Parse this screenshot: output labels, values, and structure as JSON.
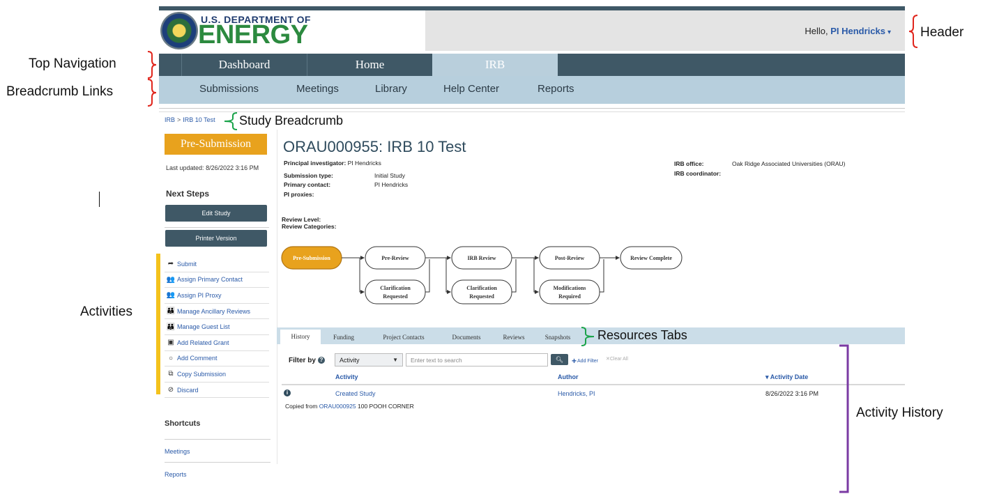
{
  "header": {
    "logo_line1": "U.S. DEPARTMENT OF",
    "logo_line2": "ENERGY",
    "greeting": "Hello,",
    "user_name": "PI Hendricks",
    "user_caret": "▾"
  },
  "top_nav": {
    "tabs": [
      {
        "label": "Dashboard"
      },
      {
        "label": "Home"
      },
      {
        "label": "IRB"
      }
    ],
    "active_tab": "IRB"
  },
  "sub_nav": {
    "links": [
      {
        "label": "Submissions"
      },
      {
        "label": "Meetings"
      },
      {
        "label": "Library"
      },
      {
        "label": "Help Center"
      },
      {
        "label": "Reports"
      }
    ]
  },
  "breadcrumb": {
    "root": "IRB",
    "separator": ">",
    "current": "IRB 10 Test"
  },
  "sidebar": {
    "status": "Pre-Submission",
    "last_updated_label": "Last updated:",
    "last_updated_value": "8/26/2022 3:16 PM",
    "next_steps_title": "Next Steps",
    "buttons": [
      {
        "label": "Edit Study"
      },
      {
        "label": "Printer Version"
      }
    ],
    "activities": [
      {
        "label": "Submit",
        "icon": "share-arrow-icon"
      },
      {
        "label": "Assign Primary Contact",
        "icon": "user-pair-icon"
      },
      {
        "label": "Assign PI Proxy",
        "icon": "user-pair-icon"
      },
      {
        "label": "Manage Ancillary Reviews",
        "icon": "user-group-icon"
      },
      {
        "label": "Manage Guest List",
        "icon": "user-group-icon"
      },
      {
        "label": "Add Related Grant",
        "icon": "document-plus-icon"
      },
      {
        "label": "Add Comment",
        "icon": "speech-bubble-icon"
      },
      {
        "label": "Copy Submission",
        "icon": "copy-icon"
      },
      {
        "label": "Discard",
        "icon": "prohibited-icon"
      }
    ],
    "shortcuts_title": "Shortcuts",
    "shortcuts": [
      {
        "label": "Meetings"
      },
      {
        "label": "Reports"
      }
    ]
  },
  "study": {
    "title": "ORAU000955: IRB 10 Test",
    "details": [
      {
        "key": "Principal investigator:",
        "value": "PI Hendricks"
      },
      {
        "key": "Submission type:",
        "value": "Initial Study"
      },
      {
        "key": "Primary contact:",
        "value": "PI Hendricks"
      },
      {
        "key": "PI proxies:",
        "value": ""
      }
    ],
    "office_details": [
      {
        "key": "IRB office:",
        "value": "Oak Ridge Associated Universities (ORAU)"
      },
      {
        "key": "IRB coordinator:",
        "value": ""
      }
    ],
    "review_level_label": "Review Level:",
    "review_categories_label": "Review Categories:"
  },
  "workflow": {
    "main_states": [
      "Pre-Submission",
      "Pre-Review",
      "IRB Review",
      "Post-Review",
      "Review Complete"
    ],
    "side_states": [
      [
        "Clarification",
        "Requested"
      ],
      [
        "Clarification",
        "Requested"
      ],
      [
        "Modifications",
        "Required"
      ]
    ],
    "active_state": "Pre-Submission",
    "active_color": "#e8a21d"
  },
  "resource_tabs": {
    "tabs": [
      {
        "label": "History"
      },
      {
        "label": "Funding"
      },
      {
        "label": "Project Contacts"
      },
      {
        "label": "Documents"
      },
      {
        "label": "Reviews"
      },
      {
        "label": "Snapshots"
      }
    ],
    "active_tab": "History"
  },
  "history": {
    "filter_label": "Filter by",
    "filter_select_value": "Activity",
    "search_placeholder": "Enter text to search",
    "add_filter_label": "Add Filter",
    "clear_all_label": "Clear All",
    "columns": [
      "Activity",
      "Author",
      "Activity Date"
    ],
    "sort_indicator": "▾",
    "rows": [
      {
        "activity": "Created Study",
        "author": "Hendricks, PI",
        "date": "8/26/2022 3:16 PM",
        "note_prefix": "Copied from",
        "note_link": "ORAU000925",
        "note_suffix": "100 POOH CORNER"
      }
    ]
  },
  "annotations": {
    "header": "Header",
    "top_navigation": "Top Navigation",
    "breadcrumb_links": "Breadcrumb  Links",
    "study_breadcrumb": "Study Breadcrumb",
    "activities": "Activities",
    "resources_tabs": "Resources Tabs",
    "activity_history": "Activity History",
    "red_color": "#e0251c",
    "green_color": "#1aa34a",
    "purple_color": "#7a3aa3",
    "yellow_color": "#f4c21c"
  }
}
